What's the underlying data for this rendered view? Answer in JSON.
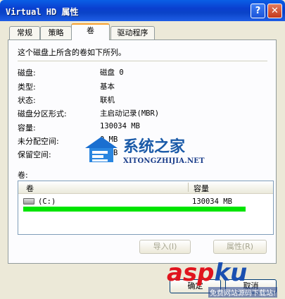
{
  "window": {
    "title": "Virtual HD 属性",
    "help_label": "?",
    "close_label": "✕"
  },
  "tabs": [
    {
      "label": "常规"
    },
    {
      "label": "策略"
    },
    {
      "label": "卷",
      "active": true
    },
    {
      "label": "驱动程序"
    }
  ],
  "panel": {
    "description": "这个磁盘上所含的卷如下所列。",
    "properties": [
      {
        "label": "磁盘:",
        "value": "磁盘 0"
      },
      {
        "label": "类型:",
        "value": "基本"
      },
      {
        "label": "状态:",
        "value": "联机"
      },
      {
        "label": "磁盘分区形式:",
        "value": "主启动记录(MBR)"
      },
      {
        "label": "容量:",
        "value": "130034 MB"
      },
      {
        "label": "未分配空间:",
        "value": "0 MB"
      },
      {
        "label": "保留空间:",
        "value": "0 MB"
      }
    ],
    "volumes_label": "卷:",
    "columns": [
      "卷",
      "容量"
    ],
    "rows": [
      {
        "volume": "(C:)",
        "capacity": "130034 MB"
      }
    ],
    "import_button": "导入(I)",
    "properties_button": "属性(R)"
  },
  "footer": {
    "ok_button": "确定",
    "cancel_button": "取消"
  },
  "watermarks": {
    "site_cn": "系统之家",
    "site_en": "XITONGZHIJIA.NET",
    "aspku_a": "asp",
    "aspku_b": "ku",
    "aspku_sub": "免费网站源码下载站!"
  },
  "colors": {
    "title_bar": "#0a43c7",
    "tab_highlight": "#f9a02d",
    "highlight_line": "#00e400"
  }
}
